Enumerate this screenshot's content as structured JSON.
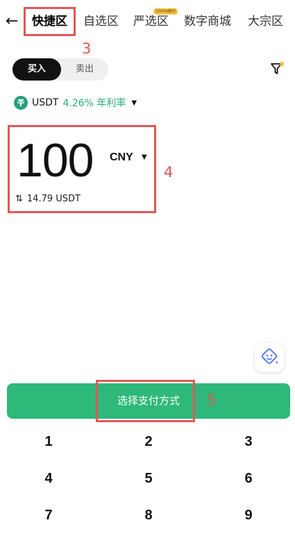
{
  "nav": {
    "tabs": [
      {
        "label": "快捷区",
        "active": true
      },
      {
        "label": "自选区",
        "active": false
      },
      {
        "label": "严选区",
        "active": false,
        "badge": "100%赔付"
      },
      {
        "label": "数字商城",
        "active": false
      },
      {
        "label": "大宗区",
        "active": false
      }
    ]
  },
  "annotations": {
    "tab": "3",
    "amount": "4",
    "pay": "5"
  },
  "trade": {
    "buy_label": "买入",
    "sell_label": "卖出",
    "mode": "buy"
  },
  "asset": {
    "symbol": "USDT",
    "rate_text": "4.26% 年利率"
  },
  "amount": {
    "value": "100",
    "currency": "CNY",
    "converted": "14.79 USDT"
  },
  "pay_button": {
    "label": "选择支付方式"
  },
  "keypad": {
    "keys": [
      "1",
      "2",
      "3",
      "4",
      "5",
      "6",
      "7",
      "8",
      "9"
    ]
  },
  "colors": {
    "accent": "#2eb87a",
    "annotation": "#e35656",
    "rate": "#27ae75"
  }
}
